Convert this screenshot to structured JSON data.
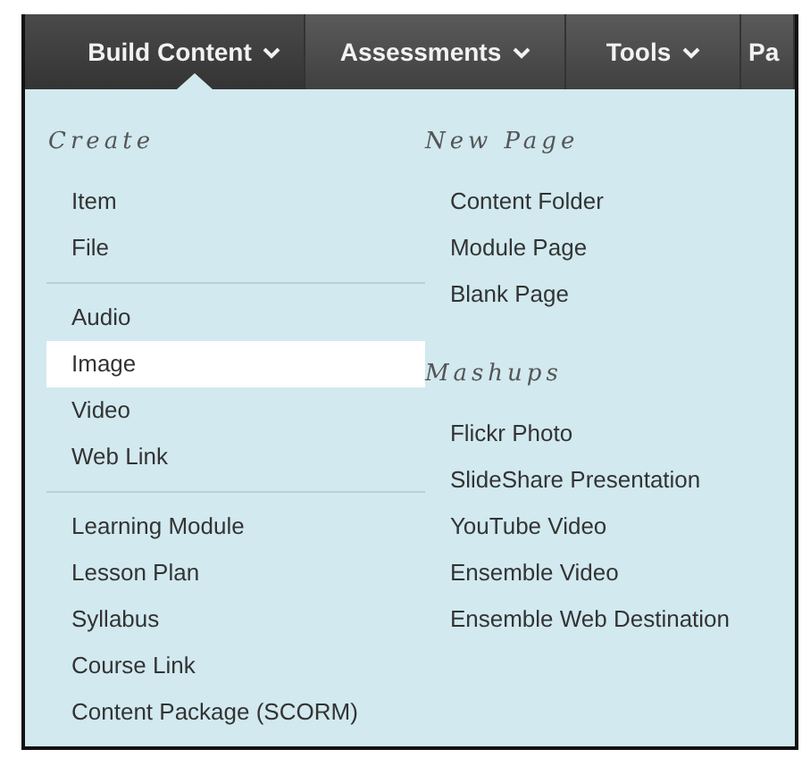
{
  "menubar": {
    "tabs": [
      {
        "label": "Build Content",
        "selected": true,
        "caret": true
      },
      {
        "label": "Assessments",
        "selected": false,
        "caret": true
      },
      {
        "label": "Tools",
        "selected": false,
        "caret": true
      },
      {
        "label": "Pa",
        "selected": false,
        "caret": false
      }
    ]
  },
  "menu": {
    "columns": [
      {
        "sections": [
          {
            "heading": "Create",
            "groups": [
              [
                {
                  "label": "Item",
                  "selected": false
                },
                {
                  "label": "File",
                  "selected": false
                }
              ],
              [
                {
                  "label": "Audio",
                  "selected": false
                },
                {
                  "label": "Image",
                  "selected": true
                },
                {
                  "label": "Video",
                  "selected": false
                },
                {
                  "label": "Web Link",
                  "selected": false
                }
              ],
              [
                {
                  "label": "Learning Module",
                  "selected": false
                },
                {
                  "label": "Lesson Plan",
                  "selected": false
                },
                {
                  "label": "Syllabus",
                  "selected": false
                },
                {
                  "label": "Course Link",
                  "selected": false
                },
                {
                  "label": "Content Package (SCORM)",
                  "selected": false
                }
              ]
            ]
          }
        ]
      },
      {
        "sections": [
          {
            "heading": "New Page",
            "groups": [
              [
                {
                  "label": "Content Folder",
                  "selected": false
                },
                {
                  "label": "Module Page",
                  "selected": false
                },
                {
                  "label": "Blank Page",
                  "selected": false
                }
              ]
            ]
          },
          {
            "heading": "Mashups",
            "groups": [
              [
                {
                  "label": "Flickr Photo",
                  "selected": false
                },
                {
                  "label": "SlideShare Presentation",
                  "selected": false
                },
                {
                  "label": "YouTube Video",
                  "selected": false
                },
                {
                  "label": "Ensemble Video",
                  "selected": false
                },
                {
                  "label": "Ensemble Web Destination",
                  "selected": false
                }
              ]
            ]
          }
        ]
      }
    ]
  }
}
